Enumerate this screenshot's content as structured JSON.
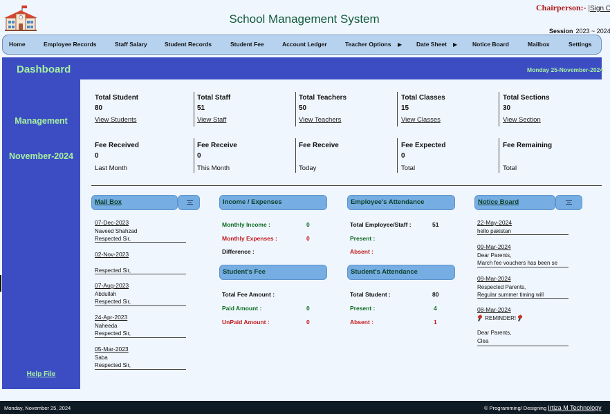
{
  "header": {
    "title": "School Management System",
    "chairperson": "Chairperson:-",
    "separator": "|",
    "sign_out": "Sign Out",
    "session_label": "Session",
    "session_value": "2023 ~ 2024"
  },
  "nav": [
    {
      "label": "Home"
    },
    {
      "label": "Employee Records"
    },
    {
      "label": "Staff Salary"
    },
    {
      "label": "Student Records"
    },
    {
      "label": "Student Fee"
    },
    {
      "label": "Account Ledger"
    },
    {
      "label": "Teacher Options"
    },
    {
      "label": "Date Sheet"
    },
    {
      "label": "Notice Board"
    },
    {
      "label": "Mailbox"
    },
    {
      "label": "Settings"
    }
  ],
  "nav_arrow": "▶",
  "sidebar": {
    "management": "Management",
    "month": "November-2024",
    "help": "Help File"
  },
  "dashboard": {
    "title": "Dashboard",
    "date": "Monday 25-November-2024"
  },
  "stats_row1": [
    {
      "label": "Total Student",
      "value": "80",
      "link": "View Students"
    },
    {
      "label": "Total Staff",
      "value": "51",
      "link": "View Staff"
    },
    {
      "label": "Total Teachers",
      "value": "50",
      "link": "View Teachers"
    },
    {
      "label": "Total Classes",
      "value": "15",
      "link": "View Classes"
    },
    {
      "label": "Total Sections",
      "value": "30",
      "link": "View Section"
    }
  ],
  "stats_row2": [
    {
      "label": "Fee Received",
      "value": "0",
      "sub": "Last Month"
    },
    {
      "label": "Fee Receive",
      "value": "0",
      "sub": "This Month"
    },
    {
      "label": "Fee Receive",
      "value": "",
      "sub": "Today"
    },
    {
      "label": "Fee Expected",
      "value": "0",
      "sub": "Total"
    },
    {
      "label": "Fee Remaining",
      "value": "",
      "sub": "Total"
    }
  ],
  "mailbox": {
    "title": "Mail Box",
    "items": [
      {
        "date": "07-Dec-2023",
        "name": "Naveed Shahzad",
        "text": "Respected Sir,"
      },
      {
        "date": "02-Nov-2023",
        "name": "",
        "text": "Respected Sir,"
      },
      {
        "date": "07-Aug-2023",
        "name": "Abdullah",
        "text": "Respected Sir,"
      },
      {
        "date": "24-Apr-2023",
        "name": "Naheeda",
        "text": "Respected Sir,"
      },
      {
        "date": "05-Mar-2023",
        "name": "Saba",
        "text": "Respected Sir,"
      }
    ]
  },
  "income": {
    "title": "Income / Expenses",
    "monthly_income_label": "Monthly Income :",
    "monthly_income_value": "0",
    "monthly_expenses_label": "Monthly Expenses :",
    "monthly_expenses_value": "0",
    "difference_label": "Difference :"
  },
  "students_fee": {
    "title": "Student's Fee",
    "total_label": "Total Fee Amount :",
    "paid_label": "Paid Amount :",
    "paid_value": "0",
    "unpaid_label": "UnPaid Amount :",
    "unpaid_value": "0"
  },
  "employee_attendance": {
    "title": "Employee's Attendance",
    "total_label": "Total Employee/Staff :",
    "total_value": "51",
    "present_label": "Present :",
    "absent_label": "Absent :"
  },
  "student_attendance": {
    "title": "Student's Attendance",
    "total_label": "Total Student :",
    "total_value": "80",
    "present_label": "Present :",
    "present_value": "4",
    "absent_label": "Absent :",
    "absent_value": "1"
  },
  "notice_board": {
    "title": "Notice Board",
    "items": [
      {
        "date": "22-May-2024",
        "line1": "hello pakistan",
        "line2": ""
      },
      {
        "date": "09-Mar-2024",
        "line1": "Dear Parents,",
        "line2": "March fee vouchers has been se"
      },
      {
        "date": "09-Mar-2024",
        "line1": "Respected Parents,",
        "line2": "Regular summer timing will"
      },
      {
        "date": "08-Mar-2024",
        "line1": "REMINDER!",
        "line2": "Dear Parents,",
        "line3": "Clea"
      }
    ]
  },
  "footer": {
    "date": "Monday, November 25, 2024",
    "credit_prefix": "© Programming/ Designing",
    "credit_name": "Irtiza M Technology"
  },
  "colors": {
    "primary": "#3c4dc4",
    "accent_green": "#a6f09e",
    "pill": "#76aee3",
    "nav": "#b6d2ef",
    "footer": "#0e1a24"
  }
}
